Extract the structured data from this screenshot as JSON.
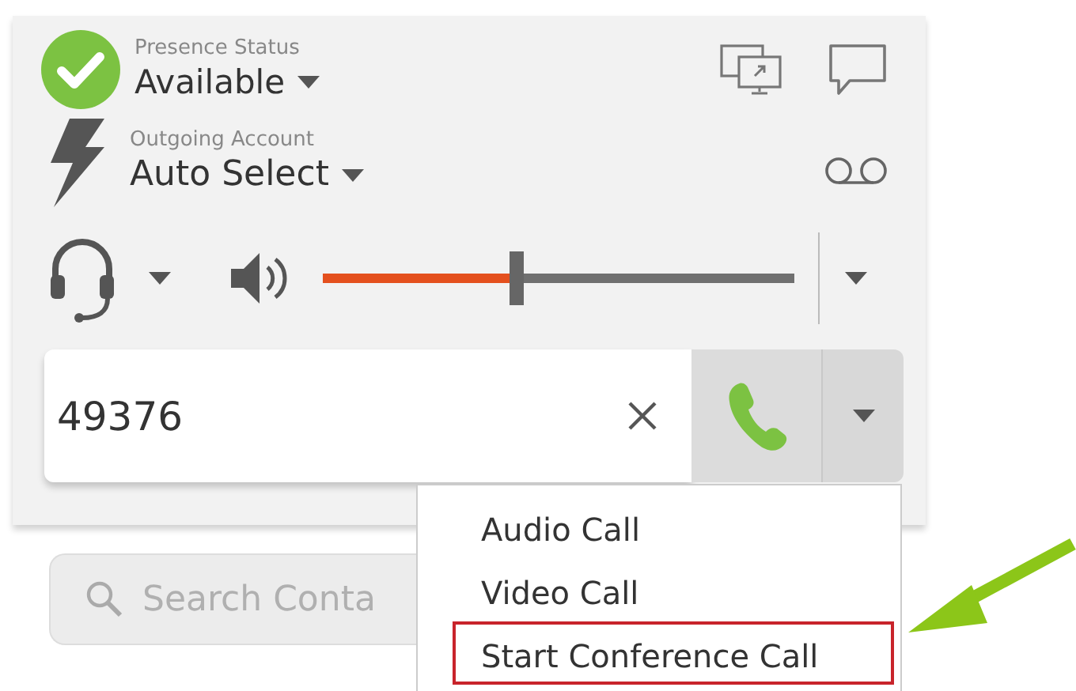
{
  "presence": {
    "label": "Presence Status",
    "value": "Available",
    "available": true
  },
  "outgoing_account": {
    "label": "Outgoing Account",
    "value": "Auto Select"
  },
  "volume": {
    "level": 0.4
  },
  "dial": {
    "value": "49376"
  },
  "call_menu": {
    "items": [
      {
        "label": "Audio Call",
        "highlighted": false
      },
      {
        "label": "Video Call",
        "highlighted": false
      },
      {
        "label": "Start Conference Call",
        "highlighted": true
      }
    ]
  },
  "search": {
    "placeholder": "Search Conta"
  }
}
